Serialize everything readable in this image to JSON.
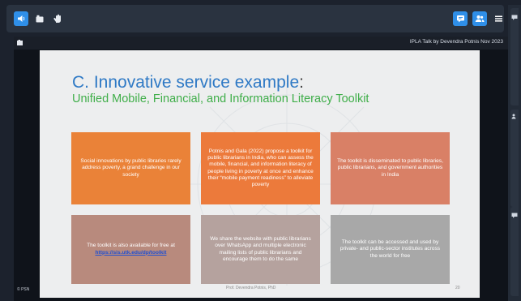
{
  "toolbar": {
    "left_icons": [
      "speaker-icon",
      "camera-icon",
      "hand-icon"
    ],
    "right_icons": [
      "chat-icon",
      "users-icon",
      "menu-icon"
    ]
  },
  "presentation": {
    "title": "IPLA Talk by Devendra Potnis Nov 2023",
    "corner_label": "PSN"
  },
  "slide": {
    "title_main": "C. Innovative service example",
    "title_colon": ":",
    "subtitle": "Unified Mobile, Financial, and Information Literacy Toolkit",
    "cards": [
      {
        "text": "Social innovations by public libraries rarely address poverty, a grand challenge in our society"
      },
      {
        "text": "Potnis and Gala (2022) propose a toolkit for public librarians in India, who can assess the mobile, financial, and information literacy of people living in poverty at once and enhance their “mobile payment readiness” to alleviate poverty"
      },
      {
        "text": "The toolkit is disseminated to public libraries, public librarians, and government authorities in India"
      },
      {
        "text": "The toolkit is also available for free at",
        "link": "https://sis.utk.edu/dp/toolkit"
      },
      {
        "text": "We share the website with public librarians over WhatsApp and multiple electronic mailing lists of public librarians and encourage them to do the same"
      },
      {
        "text": "The toolkit can be accessed and used by private- and public-sector institutes across the world for free"
      }
    ],
    "footer": "Prof. Devendra Potnis, PhD",
    "page_number": "20"
  },
  "colors": {
    "accent_blue": "#2f8fe8",
    "title_blue": "#2e79c5",
    "subtitle_green": "#3fae49",
    "card_orange": "#ea8238",
    "card_salmon": "#d98066",
    "card_grey": "#a8a8a8"
  }
}
